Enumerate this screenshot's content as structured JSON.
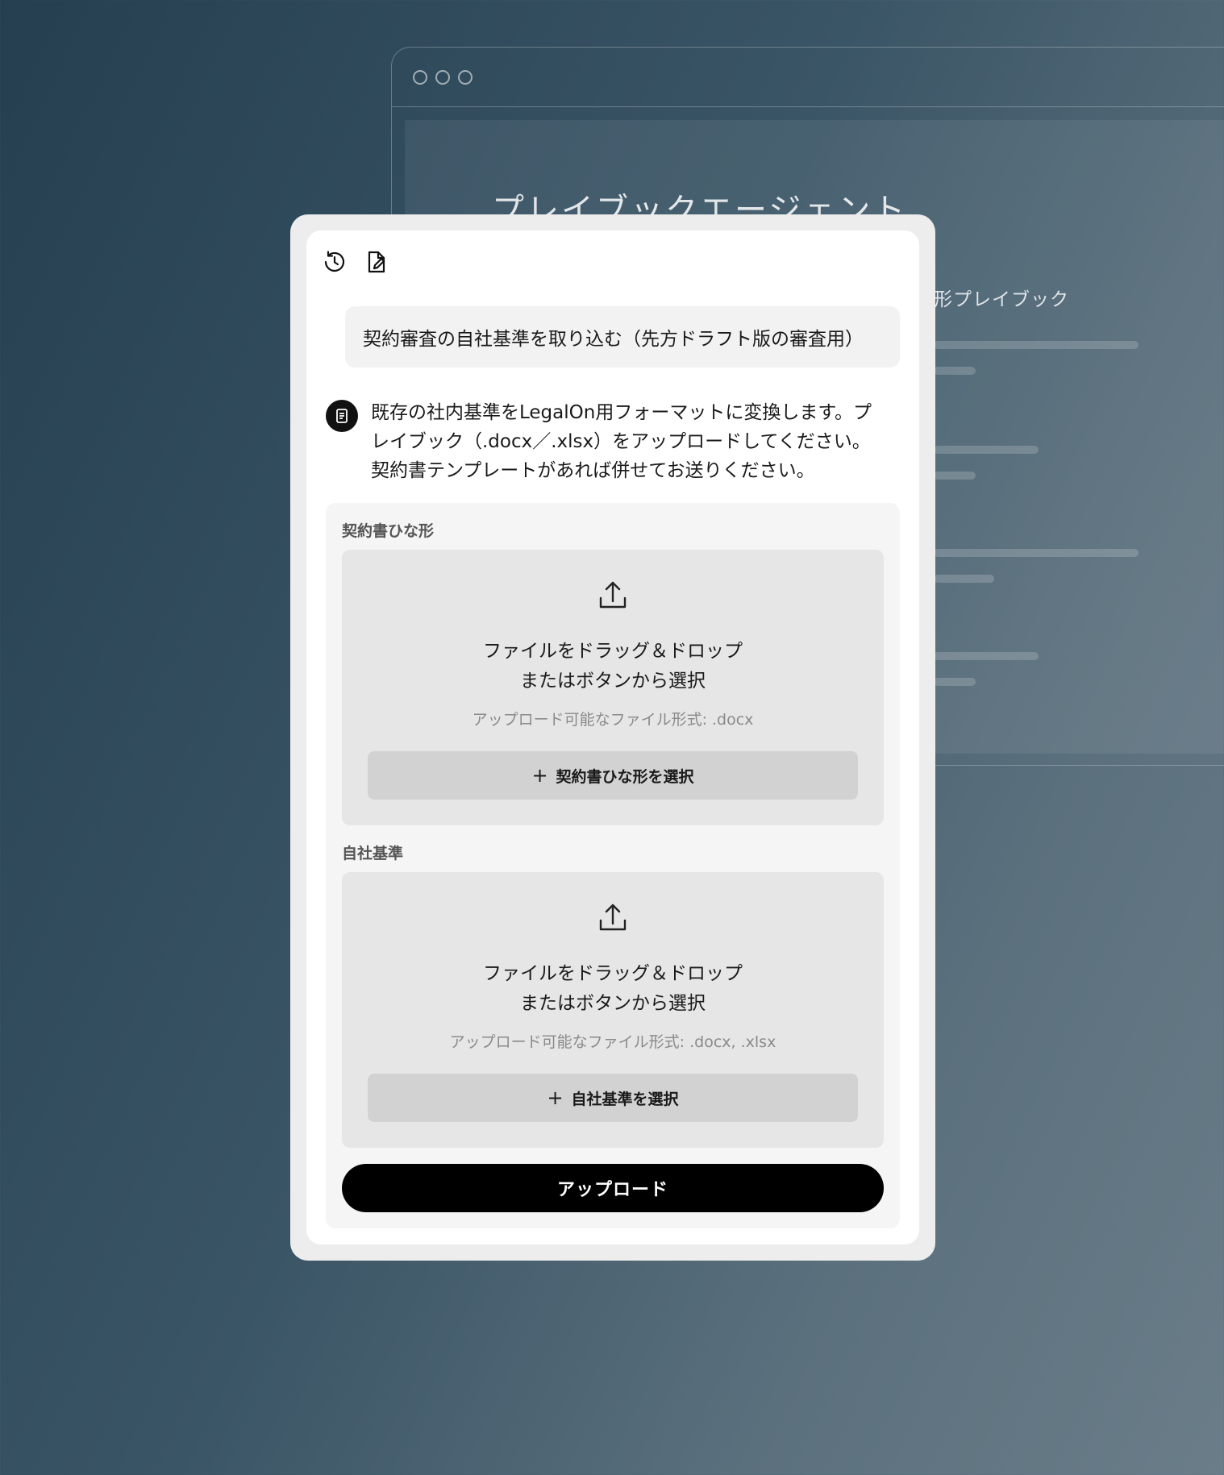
{
  "background_window": {
    "title": "プレイブックエージェント",
    "subtitle": "形プレイブック"
  },
  "panel": {
    "toolbar": {
      "history_icon": "history-icon",
      "new_chat_icon": "edit-document-icon"
    },
    "user_message": "契約審査の自社基準を取り込む（先方ドラフト版の審査用）",
    "agent_message": {
      "lines": [
        "既存の社内基準をLegalOn用フォーマットに変換します。プ",
        "レイブック（.docx／.xlsx）をアップロードしてください。",
        "契約書テンプレートがあれば併せてお送りください。"
      ]
    },
    "sections": [
      {
        "label": "契約書ひな形",
        "drop_text_line1": "ファイルをドラッグ＆ドロップ",
        "drop_text_line2": "またはボタンから選択",
        "formats": "アップロード可能なファイル形式: .docx",
        "button_label": "契約書ひな形を選択"
      },
      {
        "label": "自社基準",
        "drop_text_line1": "ファイルをドラッグ＆ドロップ",
        "drop_text_line2": "またはボタンから選択",
        "formats": "アップロード可能なファイル形式: .docx, .xlsx",
        "button_label": "自社基準を選択"
      }
    ],
    "submit_label": "アップロード"
  },
  "colors": {
    "primary_button": "#000000",
    "drop_zone": "#e6e6e6",
    "secondary_button": "#d2d2d2"
  }
}
